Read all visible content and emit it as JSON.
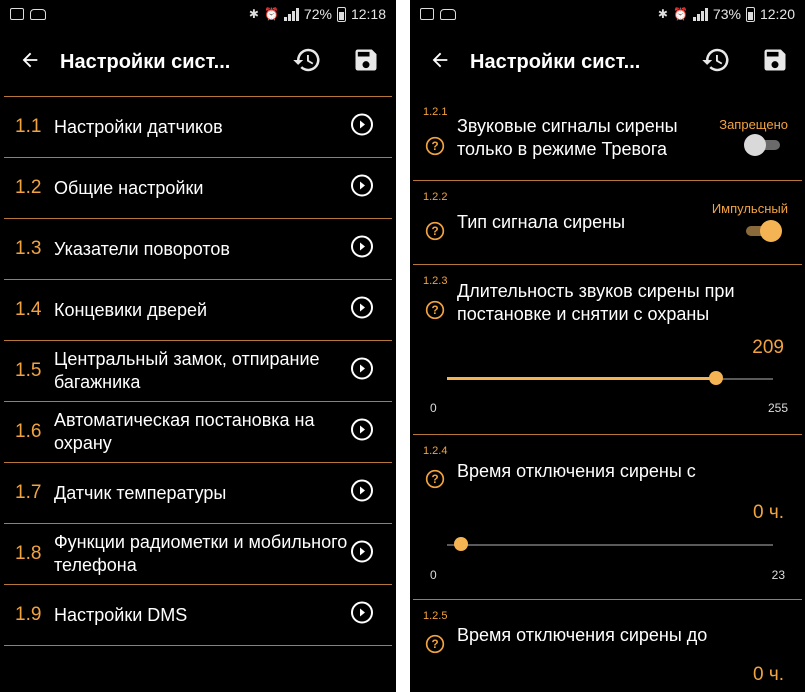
{
  "left": {
    "status": {
      "battery": "72%",
      "time": "12:18"
    },
    "title": "Настройки сист...",
    "items": [
      {
        "num": "1.1",
        "label": "Настройки датчиков"
      },
      {
        "num": "1.2",
        "label": "Общие настройки"
      },
      {
        "num": "1.3",
        "label": "Указатели поворотов"
      },
      {
        "num": "1.4",
        "label": "Концевики дверей"
      },
      {
        "num": "1.5",
        "label": "Центральный замок, отпирание багажника"
      },
      {
        "num": "1.6",
        "label": "Автоматическая постановка на охрану"
      },
      {
        "num": "1.7",
        "label": "Датчик температуры"
      },
      {
        "num": "1.8",
        "label": "Функции радиометки и мобильного телефона"
      },
      {
        "num": "1.9",
        "label": "Настройки DMS"
      }
    ]
  },
  "right": {
    "status": {
      "battery": "73%",
      "time": "12:20"
    },
    "title": "Настройки сист...",
    "settings": [
      {
        "code": "1.2.1",
        "title": "Звуковые сигналы сирены только в режиме Тревога",
        "state": "Запрещено",
        "on": false
      },
      {
        "code": "1.2.2",
        "title": "Тип сигнала сирены",
        "state": "Импульсный",
        "on": true
      },
      {
        "code": "1.2.3",
        "title": "Длительность звуков сирены при постановке и снятии с охраны",
        "value": "209",
        "min": "0",
        "max": "255",
        "level": 209
      },
      {
        "code": "1.2.4",
        "title": "Время отключения сирены с",
        "value": "0 ч.",
        "min": "0",
        "max": "23",
        "level": 0
      },
      {
        "code": "1.2.5",
        "title": "Время отключения сирены до",
        "value": "0 ч."
      }
    ]
  },
  "colors": {
    "accent": "#f2a341",
    "divider": "#b8773a",
    "background": "#000000"
  },
  "icons": [
    "back-arrow-icon",
    "history-icon",
    "save-icon",
    "play-circle-icon",
    "help-circle-icon"
  ]
}
